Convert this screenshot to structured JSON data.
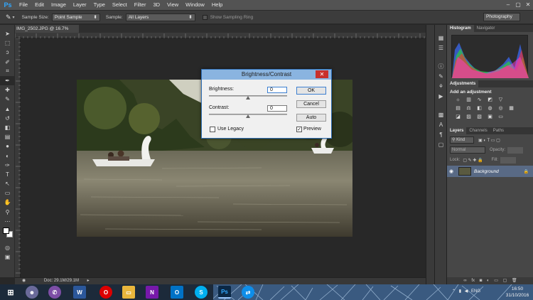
{
  "app": {
    "logo": "Ps",
    "menu": [
      "File",
      "Edit",
      "Image",
      "Layer",
      "Type",
      "Select",
      "Filter",
      "3D",
      "View",
      "Window",
      "Help"
    ],
    "window_controls": [
      "–",
      "▢",
      "✕"
    ]
  },
  "options": {
    "sample_size_label": "Sample Size:",
    "sample_size_value": "Point Sample",
    "sample_label": "Sample:",
    "sample_value": "All Layers",
    "sampling_ring_label": "Show Sampling Ring",
    "workspace": "Photography"
  },
  "document": {
    "tab_title": "IMG_2502.JPG @ 16.7% (RGB/8)",
    "tab_close": "×",
    "status": "Doc: 29.1M/29.1M"
  },
  "dialog": {
    "title": "Brightness/Contrast",
    "close": "✕",
    "brightness_label": "Brightness:",
    "brightness_value": "0",
    "contrast_label": "Contrast:",
    "contrast_value": "0",
    "ok_label": "OK",
    "cancel_label": "Cancel",
    "auto_label": "Auto",
    "use_legacy_label": "Use Legacy",
    "use_legacy_checked": false,
    "preview_label": "Preview",
    "preview_checked": true
  },
  "panels": {
    "histogram_tabs": [
      "Histogram",
      "Navigator"
    ],
    "adjustments_tab": "Adjustments",
    "adjustments_hint": "Add an adjustment",
    "layers_tabs": [
      "Layers",
      "Channels",
      "Paths"
    ],
    "kind_label": "Kind",
    "blend_mode": "Normal",
    "opacity_label": "Opacity:",
    "lock_label": "Lock:",
    "fill_label": "Fill:",
    "layer_name": "Background"
  },
  "taskbar": {
    "language": "ENG",
    "time": "16:50",
    "date": "31/10/2016"
  },
  "icons": {
    "tools": [
      "move-icon",
      "marquee-icon",
      "lasso-icon",
      "quick-select-icon",
      "crop-icon",
      "eyedropper-icon",
      "healing-icon",
      "brush-icon",
      "stamp-icon",
      "history-brush-icon",
      "eraser-icon",
      "gradient-icon",
      "blur-icon",
      "dodge-icon",
      "pen-icon",
      "type-icon",
      "path-select-icon",
      "shape-icon",
      "hand-icon",
      "zoom-icon"
    ]
  },
  "colors": {
    "accent_blue": "#31a8ff",
    "dialog_title": "#8ab4e0",
    "close_red": "#c9302c"
  }
}
